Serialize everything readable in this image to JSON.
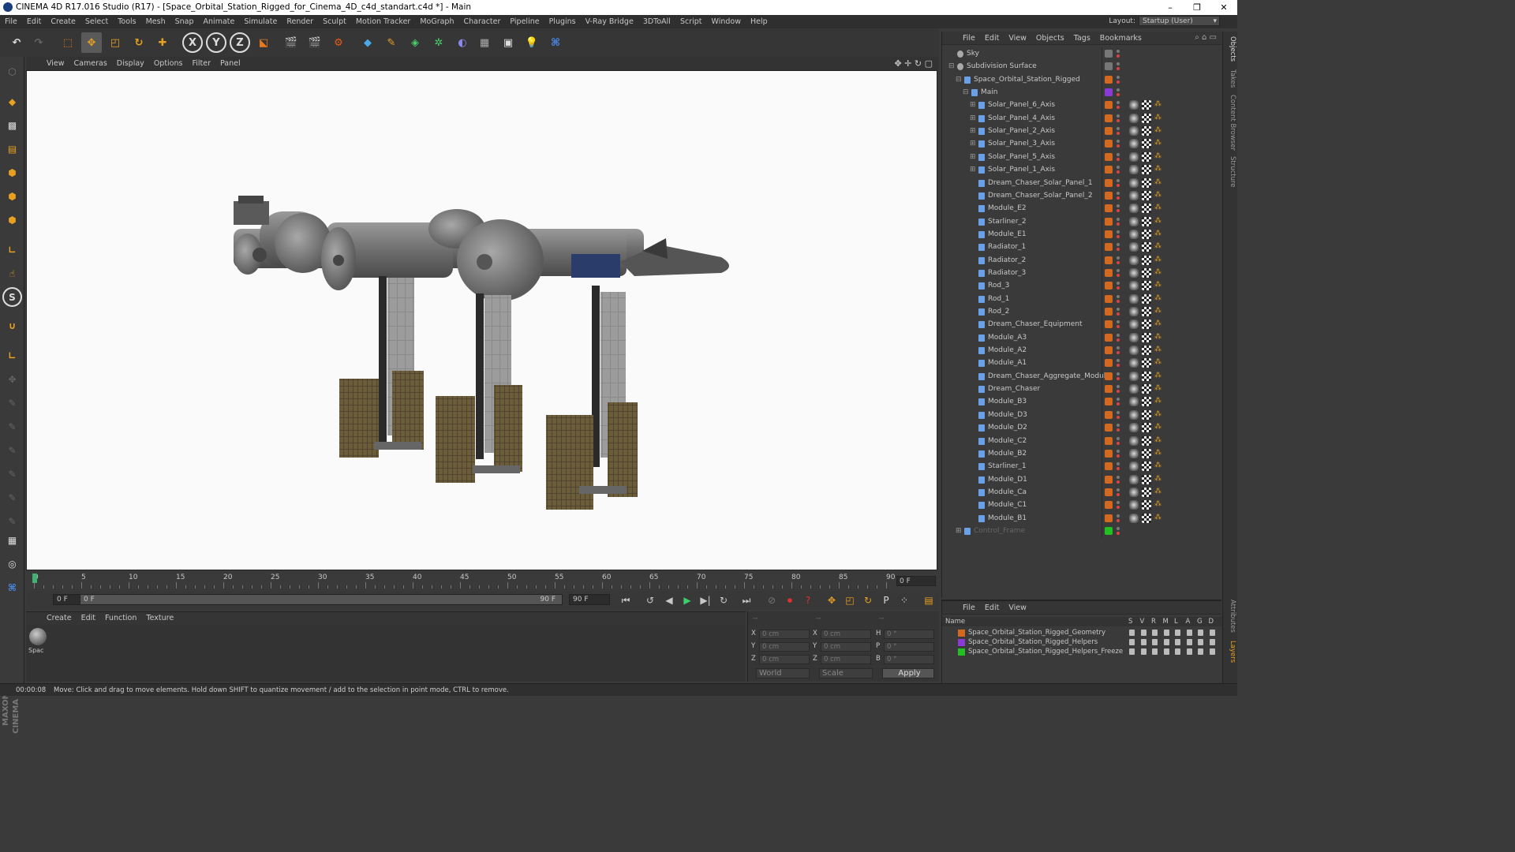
{
  "window": {
    "title": "CINEMA 4D R17.016 Studio (R17) - [Space_Orbital_Station_Rigged_for_Cinema_4D_c4d_standart.c4d *] - Main",
    "minimize": "–",
    "maximize": "❐",
    "close": "✕"
  },
  "menu": [
    "File",
    "Edit",
    "Create",
    "Select",
    "Tools",
    "Mesh",
    "Snap",
    "Animate",
    "Simulate",
    "Render",
    "Sculpt",
    "Motion Tracker",
    "MoGraph",
    "Character",
    "Pipeline",
    "Plugins",
    "V-Ray Bridge",
    "3DToAll",
    "Script",
    "Window",
    "Help"
  ],
  "layout": {
    "label": "Layout:",
    "value": "Startup (User)"
  },
  "toolbar_icons": [
    "undo-icon",
    "redo-icon",
    "live-select-icon",
    "move-icon",
    "scale-icon",
    "rotate-icon",
    "add-icon",
    "x-axis-icon",
    "y-axis-icon",
    "z-axis-icon",
    "coordinate-system-icon",
    "render-view-icon",
    "render-picture-viewer-icon",
    "edit-render-settings-icon",
    "cube-icon",
    "pen-icon",
    "subdivision-icon",
    "cloner-icon",
    "deformer-icon",
    "floor-icon",
    "camera-icon",
    "light-icon",
    "python-icon"
  ],
  "toolbar_axes": {
    "x": "X",
    "y": "Y",
    "z": "Z"
  },
  "viewport": {
    "menu": [
      "View",
      "Cameras",
      "Display",
      "Options",
      "Filter",
      "Panel"
    ],
    "bg": "#fafafa"
  },
  "timeline": {
    "ticks": [
      "0",
      "5",
      "10",
      "15",
      "20",
      "25",
      "30",
      "35",
      "40",
      "45",
      "50",
      "55",
      "60",
      "65",
      "70",
      "75",
      "80",
      "85",
      "90"
    ],
    "current": "0 F"
  },
  "playback": {
    "start": "0 F",
    "range_start": "0 F",
    "range_end": "90 F",
    "end": "90 F"
  },
  "material_manager": {
    "menu": [
      "Create",
      "Edit",
      "Function",
      "Texture"
    ],
    "material_name": "Spac"
  },
  "coords": {
    "header": [
      "--",
      "--",
      "--"
    ],
    "rows": [
      {
        "a": "X",
        "av": "0 cm",
        "b": "X",
        "bv": "0 cm",
        "c": "H",
        "cv": "0 °"
      },
      {
        "a": "Y",
        "av": "0 cm",
        "b": "Y",
        "bv": "0 cm",
        "c": "P",
        "cv": "0 °"
      },
      {
        "a": "Z",
        "av": "0 cm",
        "b": "Z",
        "bv": "0 cm",
        "c": "B",
        "cv": "0 °"
      }
    ],
    "mode": "World",
    "size": "Scale",
    "apply": "Apply"
  },
  "status": {
    "time": "00:00:08",
    "message": "Move: Click and drag to move elements. Hold down SHIFT to quantize movement / add to the selection in point mode, CTRL to remove."
  },
  "object_manager": {
    "menu": [
      "File",
      "Edit",
      "View",
      "Objects",
      "Tags",
      "Bookmarks"
    ],
    "objects": [
      {
        "name": "Sky",
        "indent": 0,
        "exp": "",
        "tag": "#777777",
        "kind": "sky"
      },
      {
        "name": "Subdivision Surface",
        "indent": 0,
        "exp": "⊟",
        "tag": "#777777",
        "kind": "sds"
      },
      {
        "name": "Space_Orbital_Station_Rigged",
        "indent": 1,
        "exp": "⊟",
        "tag": "#d2691e",
        "kind": "null"
      },
      {
        "name": "Main",
        "indent": 2,
        "exp": "⊟",
        "tag": "#8a3bd6",
        "kind": "joint"
      },
      {
        "name": "Solar_Panel_6_Axis",
        "indent": 3,
        "exp": "⊞",
        "tag": "#d2691e",
        "kind": "joint"
      },
      {
        "name": "Solar_Panel_4_Axis",
        "indent": 3,
        "exp": "⊞",
        "tag": "#d2691e",
        "kind": "joint"
      },
      {
        "name": "Solar_Panel_2_Axis",
        "indent": 3,
        "exp": "⊞",
        "tag": "#d2691e",
        "kind": "joint"
      },
      {
        "name": "Solar_Panel_3_Axis",
        "indent": 3,
        "exp": "⊞",
        "tag": "#d2691e",
        "kind": "joint"
      },
      {
        "name": "Solar_Panel_5_Axis",
        "indent": 3,
        "exp": "⊞",
        "tag": "#d2691e",
        "kind": "joint"
      },
      {
        "name": "Solar_Panel_1_Axis",
        "indent": 3,
        "exp": "⊞",
        "tag": "#d2691e",
        "kind": "joint"
      },
      {
        "name": "Dream_Chaser_Solar_Panel_1",
        "indent": 3,
        "exp": "",
        "tag": "#d2691e",
        "kind": "joint"
      },
      {
        "name": "Dream_Chaser_Solar_Panel_2",
        "indent": 3,
        "exp": "",
        "tag": "#d2691e",
        "kind": "joint"
      },
      {
        "name": "Module_E2",
        "indent": 3,
        "exp": "",
        "tag": "#d2691e",
        "kind": "joint"
      },
      {
        "name": "Starliner_2",
        "indent": 3,
        "exp": "",
        "tag": "#d2691e",
        "kind": "joint"
      },
      {
        "name": "Module_E1",
        "indent": 3,
        "exp": "",
        "tag": "#d2691e",
        "kind": "joint"
      },
      {
        "name": "Radiator_1",
        "indent": 3,
        "exp": "",
        "tag": "#d2691e",
        "kind": "joint"
      },
      {
        "name": "Radiator_2",
        "indent": 3,
        "exp": "",
        "tag": "#d2691e",
        "kind": "joint"
      },
      {
        "name": "Radiator_3",
        "indent": 3,
        "exp": "",
        "tag": "#d2691e",
        "kind": "joint"
      },
      {
        "name": "Rod_3",
        "indent": 3,
        "exp": "",
        "tag": "#d2691e",
        "kind": "joint"
      },
      {
        "name": "Rod_1",
        "indent": 3,
        "exp": "",
        "tag": "#d2691e",
        "kind": "joint"
      },
      {
        "name": "Rod_2",
        "indent": 3,
        "exp": "",
        "tag": "#d2691e",
        "kind": "joint"
      },
      {
        "name": "Dream_Chaser_Equipment",
        "indent": 3,
        "exp": "",
        "tag": "#d2691e",
        "kind": "joint"
      },
      {
        "name": "Module_A3",
        "indent": 3,
        "exp": "",
        "tag": "#d2691e",
        "kind": "joint"
      },
      {
        "name": "Module_A2",
        "indent": 3,
        "exp": "",
        "tag": "#d2691e",
        "kind": "joint"
      },
      {
        "name": "Module_A1",
        "indent": 3,
        "exp": "",
        "tag": "#d2691e",
        "kind": "joint"
      },
      {
        "name": "Dream_Chaser_Aggregate_Module",
        "indent": 3,
        "exp": "",
        "tag": "#d2691e",
        "kind": "joint"
      },
      {
        "name": "Dream_Chaser",
        "indent": 3,
        "exp": "",
        "tag": "#d2691e",
        "kind": "joint"
      },
      {
        "name": "Module_B3",
        "indent": 3,
        "exp": "",
        "tag": "#d2691e",
        "kind": "joint"
      },
      {
        "name": "Module_D3",
        "indent": 3,
        "exp": "",
        "tag": "#d2691e",
        "kind": "joint"
      },
      {
        "name": "Module_D2",
        "indent": 3,
        "exp": "",
        "tag": "#d2691e",
        "kind": "joint"
      },
      {
        "name": "Module_C2",
        "indent": 3,
        "exp": "",
        "tag": "#d2691e",
        "kind": "joint"
      },
      {
        "name": "Module_B2",
        "indent": 3,
        "exp": "",
        "tag": "#d2691e",
        "kind": "joint"
      },
      {
        "name": "Starliner_1",
        "indent": 3,
        "exp": "",
        "tag": "#d2691e",
        "kind": "joint"
      },
      {
        "name": "Module_D1",
        "indent": 3,
        "exp": "",
        "tag": "#d2691e",
        "kind": "joint"
      },
      {
        "name": "Module_Ca",
        "indent": 3,
        "exp": "",
        "tag": "#d2691e",
        "kind": "joint"
      },
      {
        "name": "Module_C1",
        "indent": 3,
        "exp": "",
        "tag": "#d2691e",
        "kind": "joint"
      },
      {
        "name": "Module_B1",
        "indent": 3,
        "exp": "",
        "tag": "#d2691e",
        "kind": "joint"
      },
      {
        "name": "Control_Frame",
        "indent": 1,
        "exp": "⊞",
        "tag": "#22c022",
        "kind": "null",
        "dim": true
      }
    ]
  },
  "layer_manager": {
    "menu": [
      "File",
      "Edit",
      "View"
    ],
    "header": {
      "name": "Name",
      "cols": [
        "S",
        "V",
        "R",
        "M",
        "L",
        "A",
        "G",
        "D"
      ]
    },
    "layers": [
      {
        "name": "Space_Orbital_Station_Rigged_Geometry",
        "color": "#d2691e"
      },
      {
        "name": "Space_Orbital_Station_Rigged_Helpers",
        "color": "#8a3bd6"
      },
      {
        "name": "Space_Orbital_Station_Rigged_Helpers_Freeze",
        "color": "#22c022"
      }
    ]
  },
  "right_tabs": [
    "Objects",
    "Takes",
    "Content Browser",
    "Structure",
    "Attributes",
    "Layers"
  ],
  "brand": "MAXON CINEMA 4D"
}
